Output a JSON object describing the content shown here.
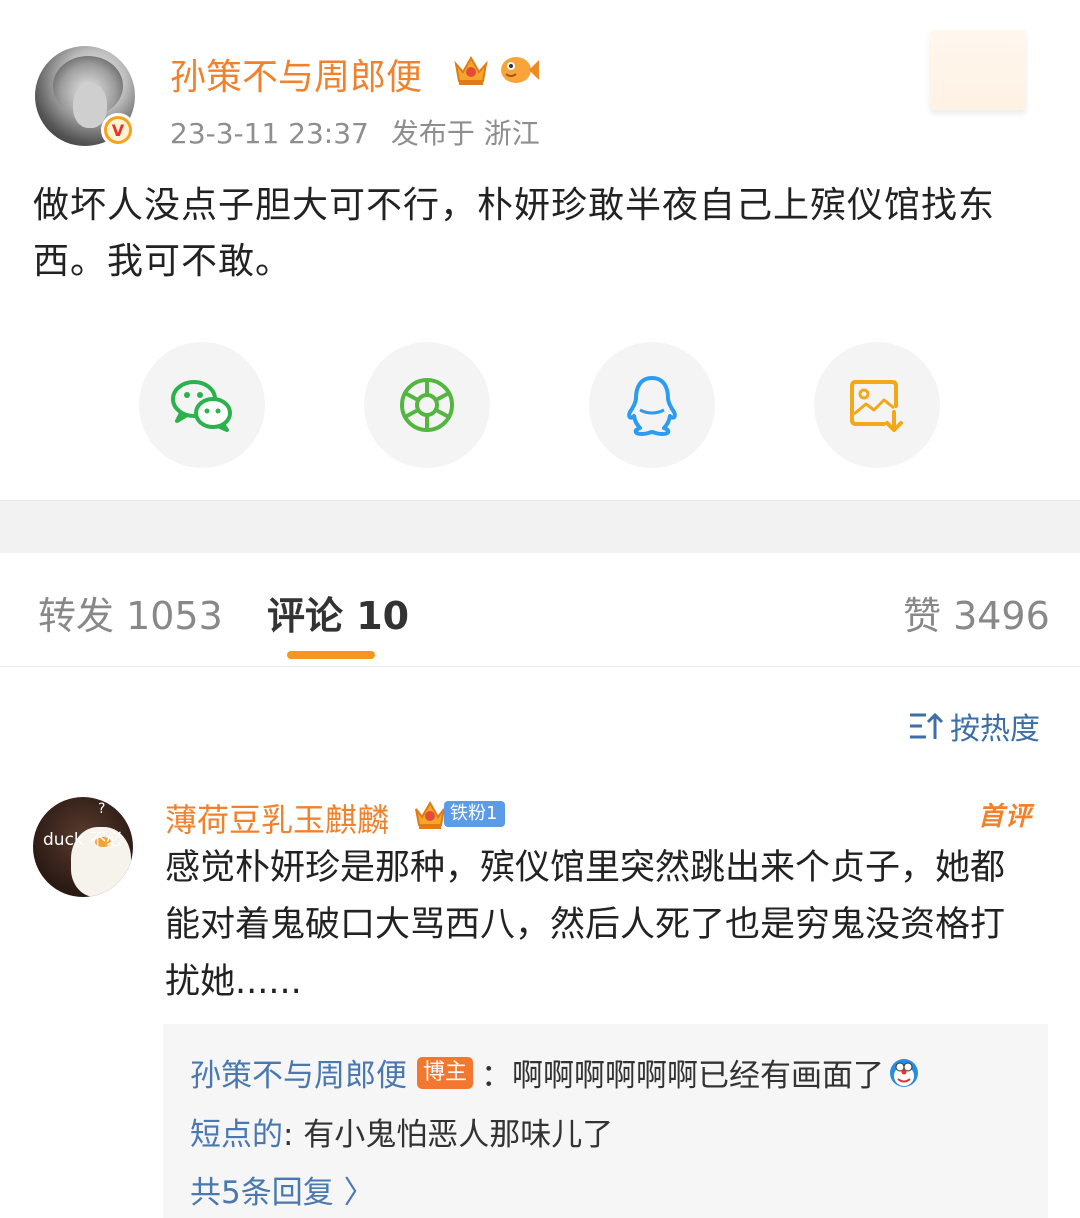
{
  "post": {
    "author": "孙策不与周郎便",
    "time": "23-3-11 23:37",
    "location": "发布于 浙江",
    "text": "做坏人没点子胆大可不行，朴妍珍敢半夜自己上殡仪馆找东西。我可不敢。",
    "verified_mark": "V"
  },
  "share": {
    "items": [
      "wechat-icon",
      "moments-icon",
      "qq-icon",
      "save-image-icon"
    ],
    "colors": {
      "wechat": "#2bb24c",
      "moments": "#52b640",
      "qq": "#2c9cf0",
      "save": "#f3a81b"
    }
  },
  "tabs": [
    {
      "label": "转发 1053"
    },
    {
      "label": "评论 10"
    },
    {
      "label": "赞 3496"
    }
  ],
  "sort": {
    "label": "按热度"
  },
  "comment": {
    "avatar_text": "duck 不必",
    "avatar_mark": "?",
    "author": "薄荷豆乳玉麒麟",
    "fan_badge": "铁粉1",
    "first_badge": "首评",
    "text": "感觉朴妍珍是那种，殡仪馆里突然跳出来个贞子，她都能对着鬼破口大骂西八，然后人死了也是穷鬼没资格打扰她......",
    "replies": [
      {
        "name": "孙策不与周郎便",
        "badge": "博主",
        "text": "：啊啊啊啊啊啊已经有画面了"
      },
      {
        "name": "短点的",
        "text": ": 有小鬼怕恶人那味儿了"
      }
    ],
    "more": "共5条回复 〉"
  },
  "colors": {
    "accent_orange": "#f0822d",
    "link_blue": "#4a78b0",
    "tab_indicator": "#f7951e"
  }
}
